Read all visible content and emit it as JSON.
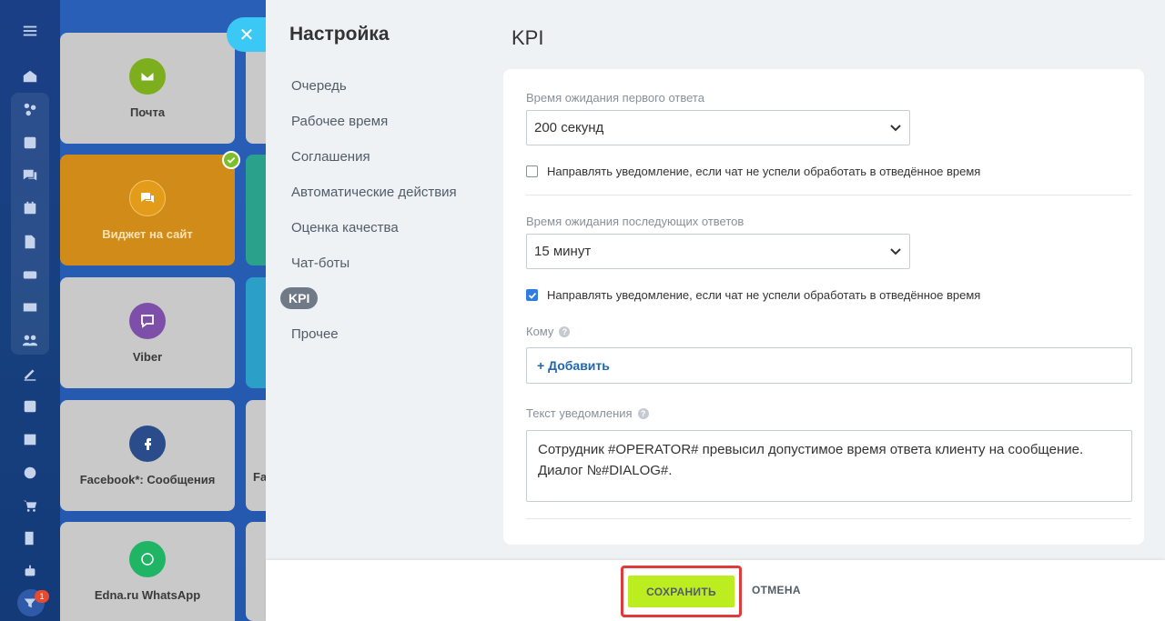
{
  "rail": {
    "icons": [
      "menu-icon",
      "home-icon",
      "crm-icon",
      "feed-icon",
      "chat-icon",
      "calendar-icon",
      "document-icon",
      "drive-icon",
      "mail-icon",
      "groups-icon",
      "sign-icon",
      "tasks-icon",
      "planner-icon",
      "goals-icon",
      "shop-icon",
      "forms-icon",
      "robot-icon",
      "filter-icon"
    ],
    "badge": "1"
  },
  "tiles": [
    {
      "label": "Почта",
      "icon": "mail-icon",
      "color": "#7cae1e"
    },
    {
      "label": "Виджет на сайт",
      "icon": "chat-icon",
      "color": "#e39b1a"
    },
    {
      "label": "Viber",
      "icon": "viber-icon",
      "color": "#7d4fa8"
    },
    {
      "label": "Facebook*: Сообщения",
      "icon": "facebook-icon",
      "color": "#2b4c8a"
    },
    {
      "label": "Edna.ru WhatsApp",
      "icon": "edna-icon",
      "color": "#1fb565"
    }
  ],
  "tile_right_partial_label": "Fa",
  "panel": {
    "title": "Настройка",
    "nav": [
      "Очередь",
      "Рабочее время",
      "Соглашения",
      "Автоматические действия",
      "Оценка качества",
      "Чат-боты",
      "KPI",
      "Прочее"
    ],
    "active_nav": "KPI",
    "section_title": "KPI"
  },
  "form": {
    "first_response_label": "Время ожидания первого ответа",
    "first_response_value": "200 секунд",
    "notify_label_1": "Направлять уведомление, если чат не успели обработать в отведённое время",
    "notify_checked_1": false,
    "next_response_label": "Время ожидания последующих ответов",
    "next_response_value": "15 минут",
    "notify_label_2": "Направлять уведомление, если чат не успели обработать в отведённое время",
    "notify_checked_2": true,
    "to_label": "Кому",
    "add_label": "+ Добавить",
    "text_label": "Текст уведомления",
    "text_value_line1": "Сотрудник #OPERATOR# превысил допустимое время ответа клиенту на сообщение.",
    "text_value_line2": "Диалог №#DIALOG#."
  },
  "footer": {
    "save": "СОХРАНИТЬ",
    "cancel": "ОТМЕНА"
  },
  "colors": {
    "accent_green": "#bbed21",
    "highlight_red": "#e03a3a",
    "link_blue": "#2067b0"
  }
}
